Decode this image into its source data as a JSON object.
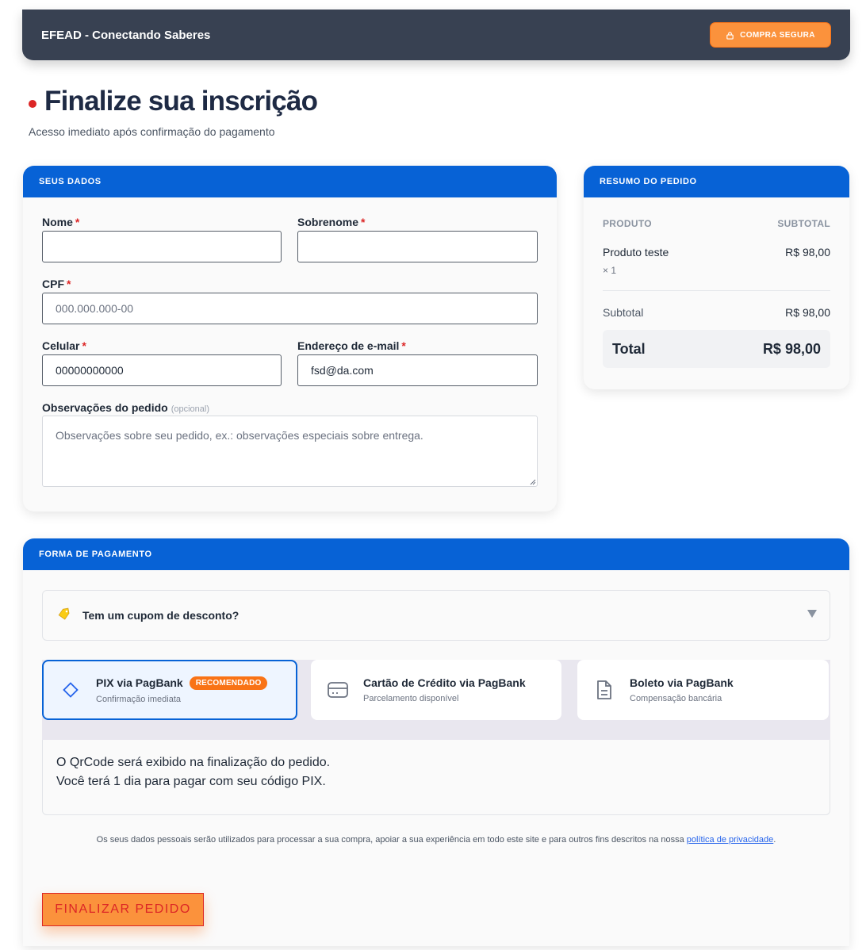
{
  "header": {
    "brand": "EFEAD - Conectando Saberes",
    "secure_label": "COMPRA SEGURA"
  },
  "page": {
    "title": "Finalize sua inscrição",
    "subtitle": "Acesso imediato após confirmação do pagamento"
  },
  "dados": {
    "header": "SEUS DADOS",
    "nome_label": "Nome",
    "nome_value": "",
    "sobrenome_label": "Sobrenome",
    "sobrenome_value": "",
    "cpf_label": "CPF",
    "cpf_placeholder": "000.000.000-00",
    "celular_label": "Celular",
    "celular_value": "00000000000",
    "email_label": "Endereço de e-mail",
    "email_value": "fsd@da.com",
    "obs_label": "Observações do pedido",
    "obs_optional": "(opcional)",
    "obs_placeholder": "Observações sobre seu pedido, ex.: observações especiais sobre entrega.",
    "required_mark": "*"
  },
  "resumo": {
    "header": "RESUMO DO PEDIDO",
    "col_produto": "PRODUTO",
    "col_subtotal": "SUBTOTAL",
    "product_name": "Produto teste",
    "product_price": "R$ 98,00",
    "product_qty": "× 1",
    "subtotal_label": "Subtotal",
    "subtotal_value": "R$ 98,00",
    "total_label": "Total",
    "total_value": "R$ 98,00"
  },
  "pagamento": {
    "header": "FORMA DE PAGAMENTO",
    "coupon_text": "Tem um cupom de desconto?",
    "methods": [
      {
        "title": "PIX via PagBank",
        "subtitle": "Confirmação imediata",
        "badge": "RECOMENDADO",
        "icon": "pix-diamond-icon",
        "selected": true
      },
      {
        "title": "Cartão de Crédito via PagBank",
        "subtitle": "Parcelamento disponível",
        "icon": "credit-card-icon",
        "selected": false
      },
      {
        "title": "Boleto via PagBank",
        "subtitle": "Compensação bancária",
        "icon": "document-icon",
        "selected": false
      }
    ],
    "pix_info_line1": "O QrCode será exibido na finalização do pedido.",
    "pix_info_line2": "Você terá 1 dia para pagar com seu código PIX.",
    "privacy_text": "Os seus dados pessoais serão utilizados para processar a sua compra, apoiar a sua experiência em todo este site e para outros fins descritos na nossa",
    "privacy_link": "política de privacidade",
    "privacy_end": ".",
    "finish_label": "FINALIZAR PEDIDO"
  },
  "colors": {
    "header_bg": "#384152",
    "primary_blue": "#0762d6",
    "accent_orange": "#fb923c",
    "required_red": "#dc2626"
  }
}
